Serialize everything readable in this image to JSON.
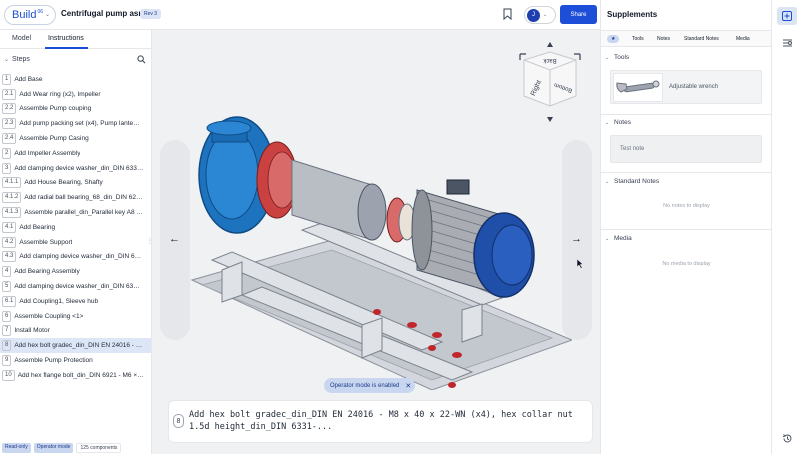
{
  "header": {
    "build_label": "Build",
    "build_version": "06",
    "doc_title": "Centrifugal pump asm",
    "revision_badge": "Rev 3",
    "user_initial": "J",
    "share_label": "Share"
  },
  "left_panel": {
    "tabs": {
      "model": "Model",
      "instructions": "Instructions"
    },
    "steps_title": "Steps",
    "steps": [
      {
        "num": "1",
        "label": "Add Base"
      },
      {
        "num": "2.1",
        "label": "Add Wear ring (x2), Impeller"
      },
      {
        "num": "2.2",
        "label": "Assemble Pump couping"
      },
      {
        "num": "2.3",
        "label": "Add pump packing set (x4), Pump lante…"
      },
      {
        "num": "2.4",
        "label": "Assemble Pump Casing"
      },
      {
        "num": "2",
        "label": "Add Impeller Assembly"
      },
      {
        "num": "3",
        "label": "Add clamping device washer_din_DIN 633…"
      },
      {
        "num": "4.1.1",
        "label": "Add House Bearing, Shafty"
      },
      {
        "num": "4.1.2",
        "label": "Add radial ball bearing_68_din_DIN 62…"
      },
      {
        "num": "4.1.3",
        "label": "Assemble parallel_din_Parallel key A8 …"
      },
      {
        "num": "4.1",
        "label": "Add Bearing"
      },
      {
        "num": "4.2",
        "label": "Assemble Support"
      },
      {
        "num": "4.3",
        "label": "Add clamping device washer_din_DIN 6…"
      },
      {
        "num": "4",
        "label": "Add Bearing Assembly"
      },
      {
        "num": "5",
        "label": "Add clamping device washer_din_DIN 63…"
      },
      {
        "num": "6.1",
        "label": "Add Coupling1, Sleeve hub"
      },
      {
        "num": "6",
        "label": "Assemble Coupling <1>"
      },
      {
        "num": "7",
        "label": "Install Motor"
      },
      {
        "num": "8",
        "label": "Add hex bolt gradec_din_DIN EN 24016 - …"
      },
      {
        "num": "9",
        "label": "Assemble Pump Protection"
      },
      {
        "num": "10",
        "label": "Add hex flange bolt_din_DIN 6921 - M6 ×…"
      }
    ],
    "active_step_index": 18,
    "footer": {
      "read_only": "Read-only",
      "operator_mode": "Operator mode",
      "components": "125 components"
    }
  },
  "viewport": {
    "cube_labels": {
      "front": "Right",
      "top": "Back",
      "side": "Bottom"
    },
    "operator_chip": "Operator mode is enabled",
    "step_number": "8",
    "step_description": "Add hex bolt gradec_din_DIN EN 24016 - M8 x 40 x 22-WN (x4), hex collar nut 1.5d height_din_DIN 6331-..."
  },
  "supplements": {
    "title": "Supplements",
    "filter_star": "★",
    "filters": {
      "tools": "Tools",
      "notes": "Notes",
      "standard_notes": "Standard Notes",
      "media": "Media"
    },
    "sections": {
      "tools": {
        "title": "Tools",
        "item": "Adjustable wrench"
      },
      "notes": {
        "title": "Notes",
        "item": "Test note"
      },
      "standard_notes": {
        "title": "Standard Notes",
        "empty": "No notes to display"
      },
      "media": {
        "title": "Media",
        "empty": "No media to display"
      }
    }
  },
  "colors": {
    "accent": "#1d4ed8",
    "pump_blue": "#1e73be",
    "motor_blue": "#1f4fa8",
    "flange_red": "#c94141"
  }
}
